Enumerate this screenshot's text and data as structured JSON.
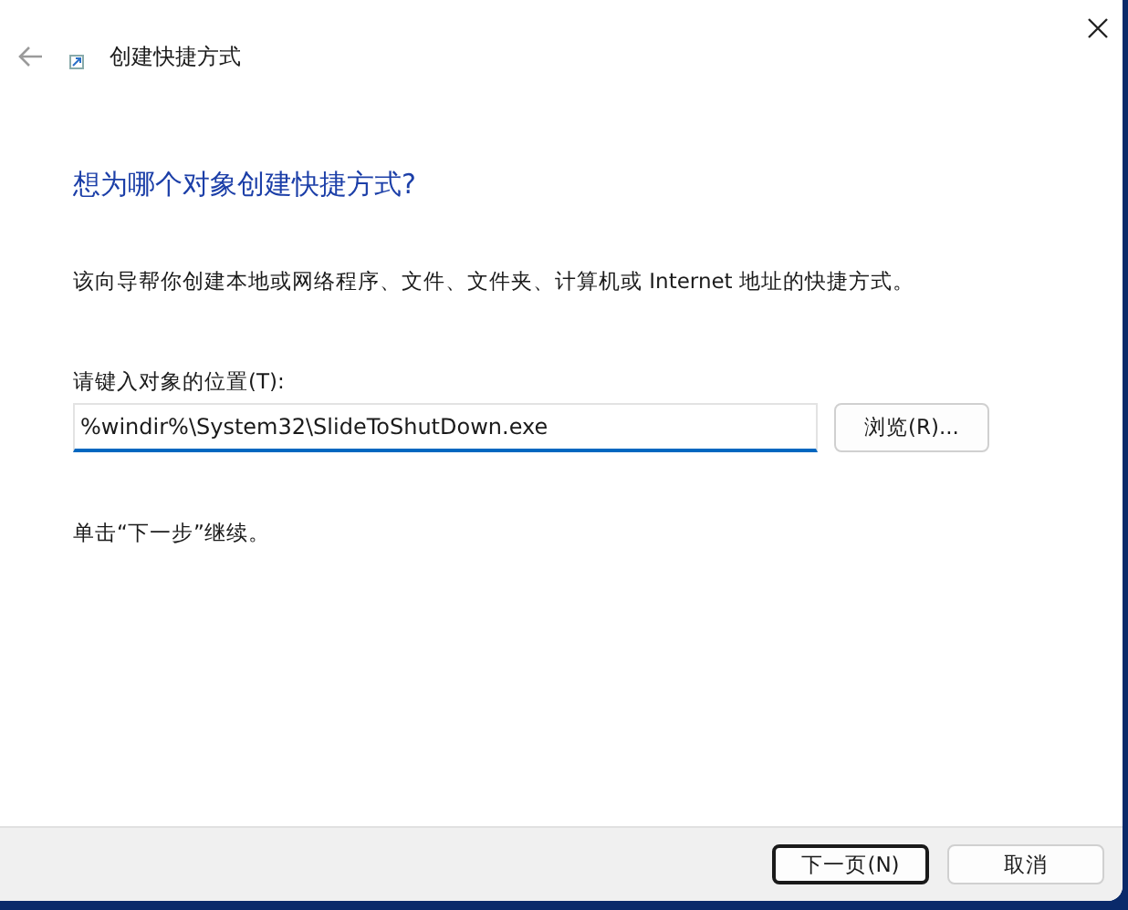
{
  "window": {
    "title": "创建快捷方式"
  },
  "heading": "想为哪个对象创建快捷方式?",
  "description": "该向导帮你创建本地或网络程序、文件、文件夹、计算机或 Internet 地址的快捷方式。",
  "location": {
    "label": "请键入对象的位置(T):",
    "value": "%windir%\\System32\\SlideToShutDown.exe",
    "browse_button": "浏览(R)..."
  },
  "hint": "单击“下一步”继续。",
  "buttons": [
    {
      "label": "下一页(N)",
      "focused": true
    },
    {
      "label": "取消",
      "focused": false
    }
  ]
}
